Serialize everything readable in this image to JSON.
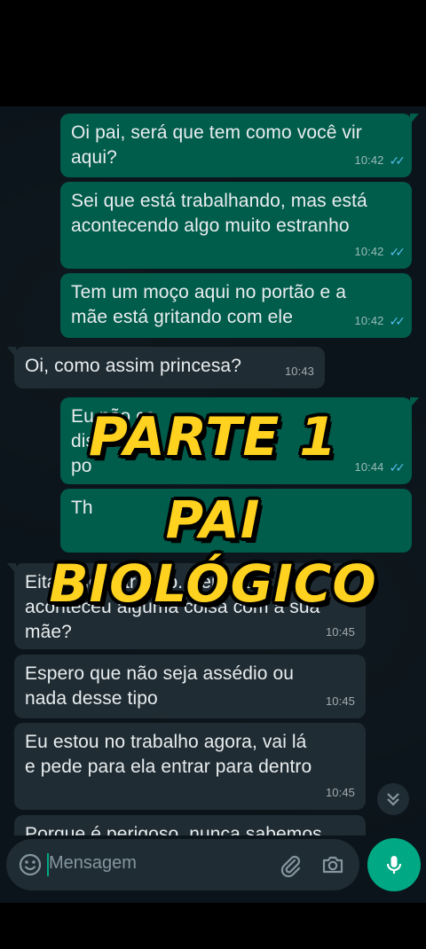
{
  "messages": [
    {
      "dir": "out",
      "text": "Oi pai, será que tem como você vir\naqui?",
      "time": "10:42",
      "read": true
    },
    {
      "dir": "out",
      "text": "Sei que está trabalhando, mas está\nacontecendo algo muito estranho",
      "time": "10:42",
      "read": true
    },
    {
      "dir": "out",
      "text": "Tem um moço aqui no portão e a\nmãe está gritando com ele",
      "time": "10:42",
      "read": true
    },
    {
      "dir": "in",
      "text": "Oi, como assim princesa?",
      "time": "10:43"
    },
    {
      "dir": "out",
      "text": "Eu não                    ço\ndis                        ho\npo",
      "time": "10:44",
      "read": true
    },
    {
      "dir": "out",
      "text": "Th",
      "time": ""
    },
    {
      "dir": "in",
      "text": "Eita, que estranho. Será que\naconteceu alguma coisa com a sua\nmãe?",
      "time": "10:45"
    },
    {
      "dir": "in",
      "text": "Espero que não seja assédio ou\nnada desse tipo",
      "time": "10:45"
    },
    {
      "dir": "in",
      "text": "Eu estou no trabalho agora, vai lá\ne pede para ela entrar para dentro",
      "time": "10:45"
    },
    {
      "dir": "in",
      "text": "Porque é perigoso, nunca sabemos",
      "time": ""
    }
  ],
  "overlay": {
    "line1": "PARTE 1",
    "line2": "PAI BIOLÓGICO"
  },
  "composer": {
    "placeholder": "Mensagem"
  },
  "icons": {
    "emoji": "emoji-icon",
    "attach": "paperclip-icon",
    "camera": "camera-icon",
    "mic": "mic-icon",
    "scroll": "chevron-double-down-icon",
    "read": "double-check-icon"
  },
  "colors": {
    "outgoing": "#005c4b",
    "incoming": "#1f2c33",
    "accent": "#00a884",
    "overlay": "#ffd21f",
    "read_ticks": "#53bdeb"
  }
}
